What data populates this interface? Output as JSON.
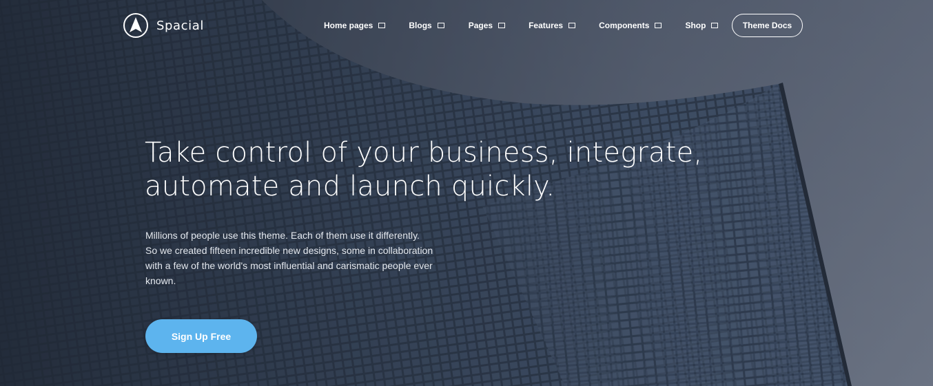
{
  "brand": {
    "name": "Spacial",
    "logo_icon": "compass-a-logo-icon"
  },
  "nav": {
    "items": [
      {
        "label": "Home pages",
        "icon": "dropdown-square-icon"
      },
      {
        "label": "Blogs",
        "icon": "dropdown-square-icon"
      },
      {
        "label": "Pages",
        "icon": "dropdown-square-icon"
      },
      {
        "label": "Features",
        "icon": "dropdown-square-icon"
      },
      {
        "label": "Components",
        "icon": "dropdown-square-icon"
      },
      {
        "label": "Shop",
        "icon": "dropdown-square-icon"
      }
    ],
    "docs_label": "Theme Docs"
  },
  "hero": {
    "headline_lines": [
      "Take control of your business, integrate,",
      "automate and launch quickly."
    ],
    "lead_lines": [
      "Millions of people use this theme. Each of them use it differently.",
      "So we created fifteen incredible new designs, some in collaboration",
      "with a few of the world's most influential and carismatic people ever",
      "known."
    ],
    "cta_label": "Sign Up Free"
  },
  "colors": {
    "cta_background": "#5db4ee",
    "text": "#ffffff",
    "overlay": "#2a3444"
  }
}
